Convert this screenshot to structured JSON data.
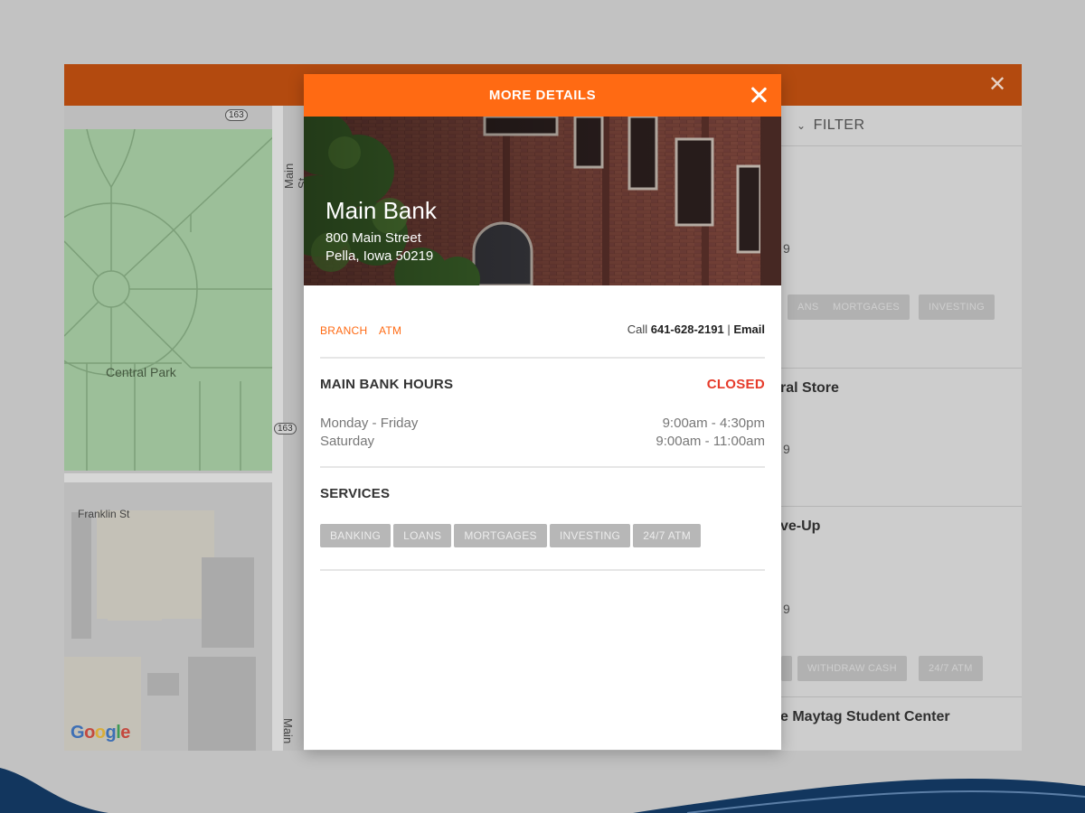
{
  "modal": {
    "title": "MORE DETAILS",
    "location": {
      "name": "Main Bank",
      "address_line1": "800 Main Street",
      "address_line2": "Pella, Iowa 50219"
    },
    "types": [
      "BRANCH",
      "ATM"
    ],
    "contact": {
      "call_prefix": "Call ",
      "phone": "641-628-2191",
      "separator": " | ",
      "email_label": "Email"
    },
    "hours": {
      "title": "MAIN BANK HOURS",
      "status": "CLOSED",
      "rows": [
        {
          "day": "Monday - Friday",
          "time": "9:00am - 4:30pm"
        },
        {
          "day": "Saturday",
          "time": "9:00am - 11:00am"
        }
      ]
    },
    "services": {
      "title": "SERVICES",
      "items": [
        "BANKING",
        "LOANS",
        "MORTGAGES",
        "INVESTING",
        "24/7 ATM"
      ]
    }
  },
  "background": {
    "filter_label": "FILTER",
    "map": {
      "park_label": "Central Park",
      "street_franklin": "Franklin St",
      "street_main": "Main St",
      "street_main_lower": "Main",
      "route_badge": "163",
      "logo": [
        "G",
        "o",
        "o",
        "g",
        "l",
        "e"
      ]
    },
    "list": {
      "partial_zip_1": "9",
      "partial_zip_2": "9",
      "partial_zip_3": "9",
      "title_2_fragment": "ral Store",
      "title_3_fragment": "ve-Up",
      "title_4_fragment": "e Maytag Student Center",
      "chips_row1": [
        "ANS",
        "MORTGAGES",
        "INVESTING"
      ],
      "chips_row3": [
        "WITHDRAW CASH",
        "24/7 ATM"
      ]
    }
  },
  "colors": {
    "accent": "#ff6a13",
    "status_closed": "#e63b2b",
    "chip_bg": "#b7b7b7"
  }
}
